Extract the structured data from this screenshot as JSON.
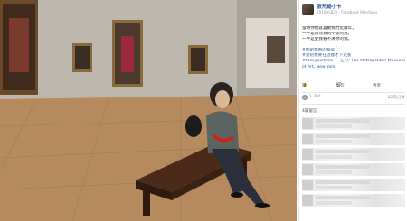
{
  "post": {
    "author": "張元楊小卡",
    "meta": "2018年某日 · Facebook Mentions",
    "caption_lines": [
      "當時你們就喜歡我們玩兩年，",
      "一半是懷你我的不斷的我，",
      "一半是愛我看不清你的我。"
    ],
    "tags_lines": [
      "#都貼我看的和得",
      "#當初我要在這裡才下定長",
      "#takeyourtime — 在 ⦿ The Metropolitan Museum",
      "of Art, New York."
    ]
  },
  "actions": {
    "like": "讚",
    "comment": "留言",
    "share": "分享"
  },
  "reactions": {
    "like_count": "1,384",
    "share_count": "82次分享"
  },
  "comments": {
    "label": "4篇留言"
  },
  "icons": {
    "like": "thumbs-up-icon",
    "comment": "speech-bubble-icon",
    "share": "share-arrow-icon"
  },
  "colors": {
    "link": "#365899",
    "like_badge": "#5890ff"
  }
}
